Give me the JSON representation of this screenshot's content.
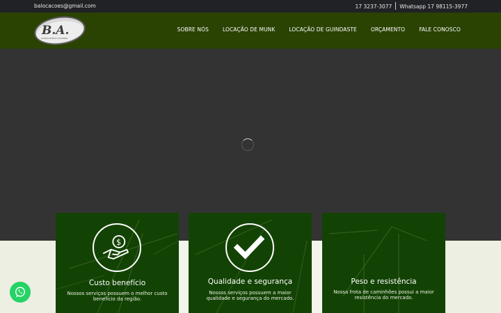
{
  "topbar": {
    "email": "balocacoes@gmail.com",
    "phone": "17 3237-3077",
    "whatsapp": "Whatsapp 17 98115-3977"
  },
  "logo": {
    "text": "B.A.",
    "subtext": "Locadora de Munck e Guindastes"
  },
  "nav": {
    "items": [
      "SOBRE NÓS",
      "LOCAÇÃO DE MUNK",
      "LOCAÇÃO DE GUINDASTE",
      "ORÇAMENTO",
      "FALE CONOSCO"
    ]
  },
  "features": [
    {
      "title": "Custo benefício",
      "text": "Nossos serviços possuem o melhor custo benefício da região.",
      "icon": "money-hand-icon"
    },
    {
      "title": "Qualidade e segurança",
      "text": "Nossos serviços possuem a maior qualidade e segurança do mercado.",
      "icon": "checkmark-icon"
    },
    {
      "title": "Peso e resistência",
      "text": "Nossa frota de caminhões possui a maior resistência do mercado.",
      "icon": "crane-icon"
    }
  ],
  "colors": {
    "topbar": "#212225",
    "navbar": "#2a4303",
    "hero": "#333333",
    "card": "#134304",
    "whatsapp": "#25d366"
  }
}
